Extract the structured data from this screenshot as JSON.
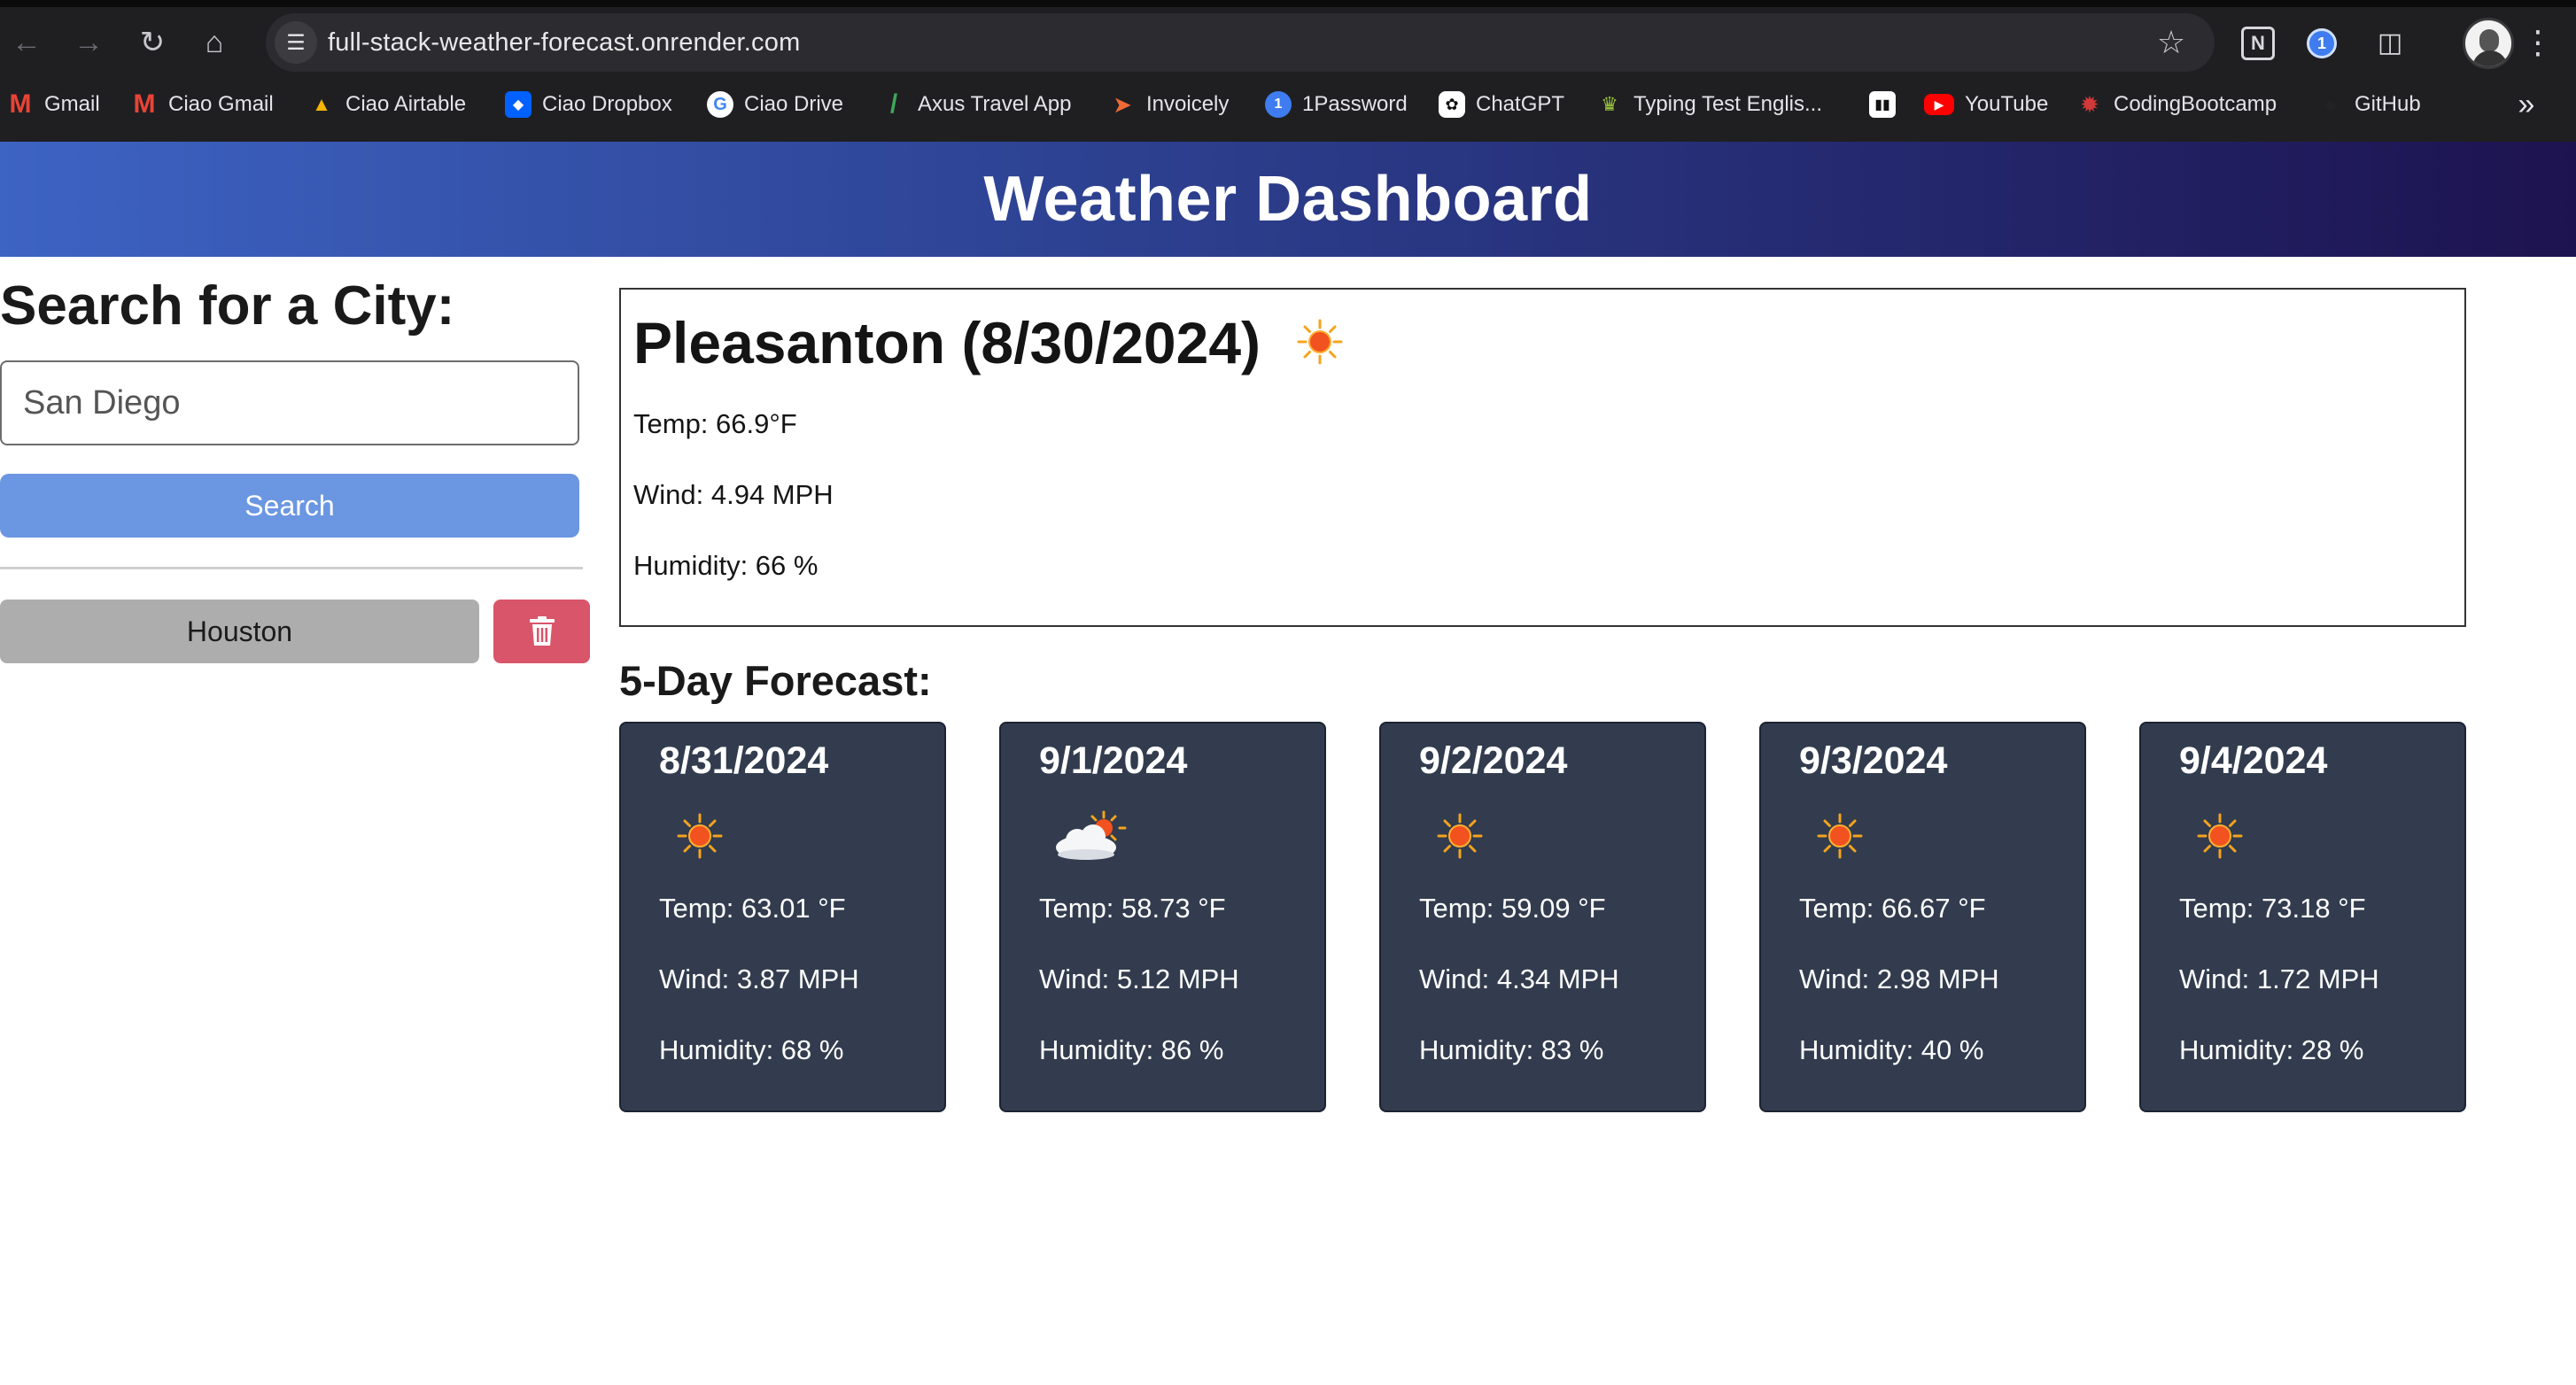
{
  "browser": {
    "url": "full-stack-weather-forecast.onrender.com",
    "bookmarks": [
      {
        "label": "Gmail",
        "icon": "gmail-icon"
      },
      {
        "label": "Ciao Gmail",
        "icon": "gmail-icon"
      },
      {
        "label": "Ciao Airtable",
        "icon": "airtable-icon"
      },
      {
        "label": "Ciao Dropbox",
        "icon": "dropbox-icon"
      },
      {
        "label": "Ciao Drive",
        "icon": "google-icon"
      },
      {
        "label": "Axus Travel App",
        "icon": "axus-icon"
      },
      {
        "label": "Invoicely",
        "icon": "invoicely-icon"
      },
      {
        "label": "1Password",
        "icon": "1password-icon"
      },
      {
        "label": "ChatGPT",
        "icon": "chatgpt-icon"
      },
      {
        "label": "Typing Test Englis...",
        "icon": "typing-test-icon"
      },
      {
        "label": "",
        "icon": "piano-icon"
      },
      {
        "label": "YouTube",
        "icon": "youtube-icon"
      },
      {
        "label": "CodingBootcamp",
        "icon": "codingbootcamp-icon"
      },
      {
        "label": "GitHub",
        "icon": "github-icon"
      }
    ]
  },
  "header": {
    "title": "Weather Dashboard"
  },
  "search": {
    "heading": "Search for a City:",
    "input_value": "San Diego",
    "button_label": "Search"
  },
  "history": {
    "items": [
      {
        "label": "Houston"
      }
    ],
    "delete_icon": "trash-icon"
  },
  "current": {
    "title": "Pleasanton (8/30/2024)",
    "icon": "sun-icon",
    "temp": "Temp: 66.9°F",
    "wind": "Wind: 4.94 MPH",
    "humidity": "Humidity: 66 %"
  },
  "forecast": {
    "heading": "5-Day Forecast:",
    "days": [
      {
        "date": "8/31/2024",
        "icon": "sun-icon",
        "temp": "Temp: 63.01 °F",
        "wind": "Wind: 3.87 MPH",
        "humidity": "Humidity: 68 %"
      },
      {
        "date": "9/1/2024",
        "icon": "partly-cloudy-icon",
        "temp": "Temp: 58.73 °F",
        "wind": "Wind: 5.12 MPH",
        "humidity": "Humidity: 86 %"
      },
      {
        "date": "9/2/2024",
        "icon": "sun-icon",
        "temp": "Temp: 59.09 °F",
        "wind": "Wind: 4.34 MPH",
        "humidity": "Humidity: 83 %"
      },
      {
        "date": "9/3/2024",
        "icon": "sun-icon",
        "temp": "Temp: 66.67 °F",
        "wind": "Wind: 2.98 MPH",
        "humidity": "Humidity: 40 %"
      },
      {
        "date": "9/4/2024",
        "icon": "sun-icon",
        "temp": "Temp: 73.18 °F",
        "wind": "Wind: 1.72 MPH",
        "humidity": "Humidity: 28 %"
      }
    ]
  }
}
